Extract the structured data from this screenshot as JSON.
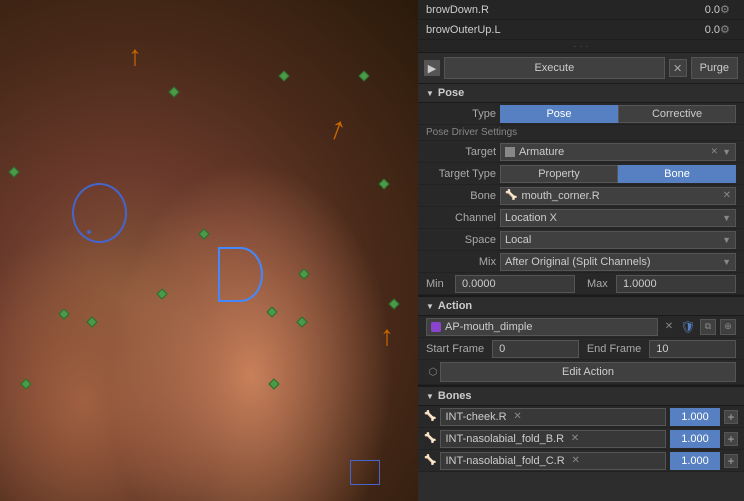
{
  "viewport": {
    "label": "3D Viewport"
  },
  "panel": {
    "top_list": {
      "rows": [
        {
          "label": "browDown.R",
          "value": "0.0"
        },
        {
          "label": "browOuterUp.L",
          "value": "0.0"
        }
      ]
    },
    "execute": {
      "execute_label": "Execute",
      "purge_label": "Purge"
    },
    "pose_section": {
      "title": "Pose",
      "type_buttons": [
        {
          "label": "Pose",
          "active": true
        },
        {
          "label": "Corrective",
          "active": false
        }
      ],
      "pose_driver_settings_label": "Pose Driver Settings",
      "target_label": "Target",
      "target_value": "Armature",
      "target_type_label": "Target Type",
      "target_type_buttons": [
        {
          "label": "Property",
          "active": false
        },
        {
          "label": "Bone",
          "active": true
        }
      ],
      "bone_label": "Bone",
      "bone_value": "mouth_corner.R",
      "channel_label": "Channel",
      "channel_value": "Location X",
      "space_label": "Space",
      "space_value": "Local",
      "mix_label": "Mix",
      "mix_value": "After Original (Split Channels)",
      "min_label": "Min",
      "min_value": "0.0000",
      "max_label": "Max",
      "max_value": "1.0000"
    },
    "action_section": {
      "title": "Action",
      "action_name": "AP-mouth_dimple",
      "start_frame_label": "Start Frame",
      "start_frame_value": "0",
      "end_frame_label": "End Frame",
      "end_frame_value": "10",
      "edit_action_label": "Edit Action"
    },
    "bones_section": {
      "title": "Bones",
      "bones": [
        {
          "name": "INT-cheek.R",
          "value": "1.000"
        },
        {
          "name": "INT-nasolabial_fold_B.R",
          "value": "1.000"
        },
        {
          "name": "INT-nasolabial_fold_C.R",
          "value": "1.000"
        }
      ]
    }
  }
}
